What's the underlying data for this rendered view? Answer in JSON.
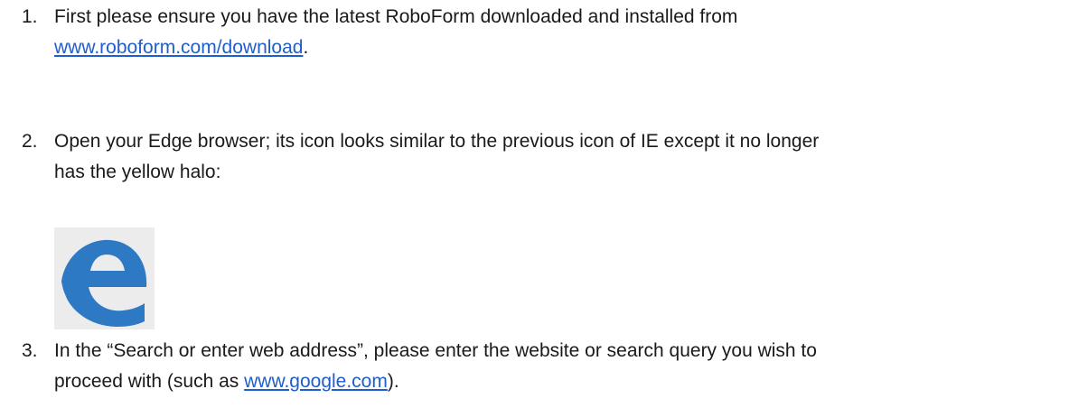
{
  "steps": [
    {
      "number": "1.",
      "line1": "First please ensure you have the latest RoboForm downloaded and installed from",
      "link": "www.roboform.com/download",
      "after_link": "."
    },
    {
      "number": "2.",
      "line1": "Open your Edge browser; its icon looks similar to the previous icon of IE except it no longer",
      "line2": "has the yellow halo:"
    },
    {
      "number": "3.",
      "line1": "In the “Search or enter web address”, please enter the website or search query you wish to",
      "line2_before": "proceed with (such as ",
      "link": "www.google.com",
      "line2_after": ")."
    }
  ],
  "icons": {
    "edge": "edge-browser-icon"
  },
  "colors": {
    "text": "#1a1a1a",
    "link": "#1f5ecc",
    "edge_blue": "#2e79c4",
    "icon_background": "#ececec"
  }
}
